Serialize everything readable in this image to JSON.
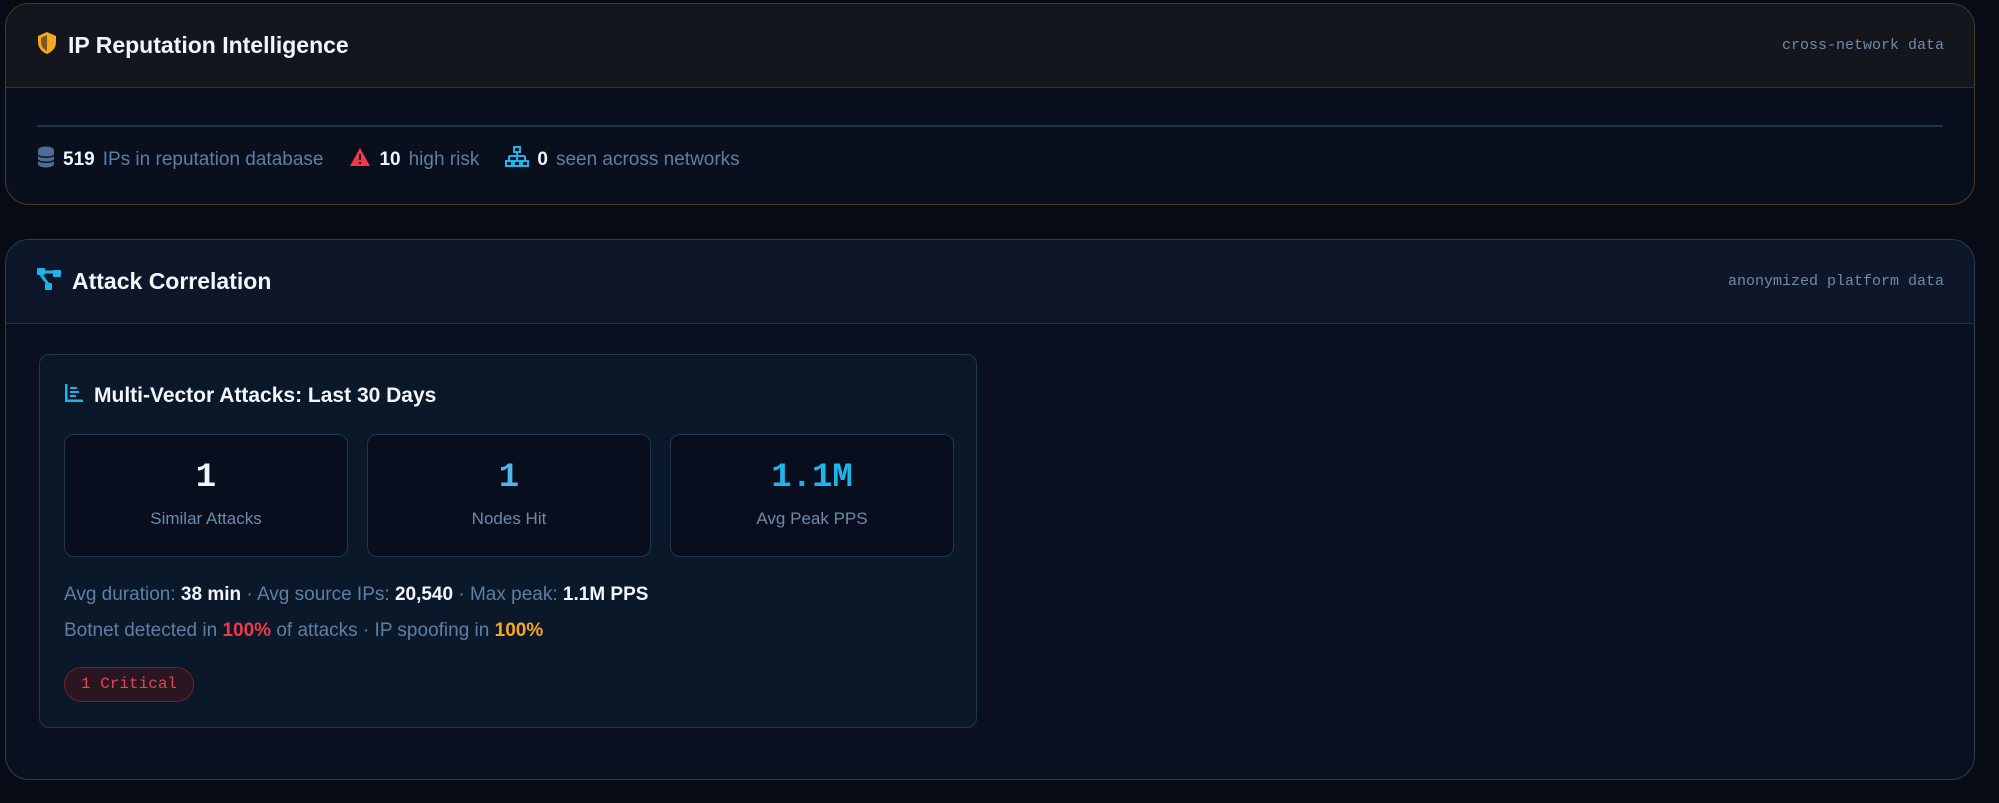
{
  "reputation": {
    "title": "IP Reputation Intelligence",
    "meta": "cross-network data",
    "stats": [
      {
        "value": "519",
        "label": "IPs in reputation database"
      },
      {
        "value": "10",
        "label": "high risk"
      },
      {
        "value": "0",
        "label": "seen across networks"
      }
    ]
  },
  "correlation": {
    "title": "Attack Correlation",
    "meta": "anonymized platform data",
    "panel": {
      "title": "Multi-Vector Attacks: Last 30 Days",
      "boxes": [
        {
          "value": "1",
          "label": "Similar Attacks"
        },
        {
          "value": "1",
          "label": "Nodes Hit"
        },
        {
          "value": "1.1M",
          "label": "Avg Peak PPS"
        }
      ],
      "avg_duration_label": "Avg duration:",
      "avg_duration": "38 min",
      "avg_ips_label": "· Avg source IPs:",
      "avg_ips": "20,540",
      "max_peak_label": "· Max peak:",
      "max_peak": "1.1M PPS",
      "botnet_label": "Botnet detected in",
      "botnet_pct": "100%",
      "botnet_suffix": "of attacks · IP spoofing in",
      "spoofing_pct": "100%",
      "badge": "1 Critical"
    }
  },
  "colors": {
    "orange": "#f5a623",
    "red": "#f0384c",
    "cyan": "#1eb4ea"
  }
}
